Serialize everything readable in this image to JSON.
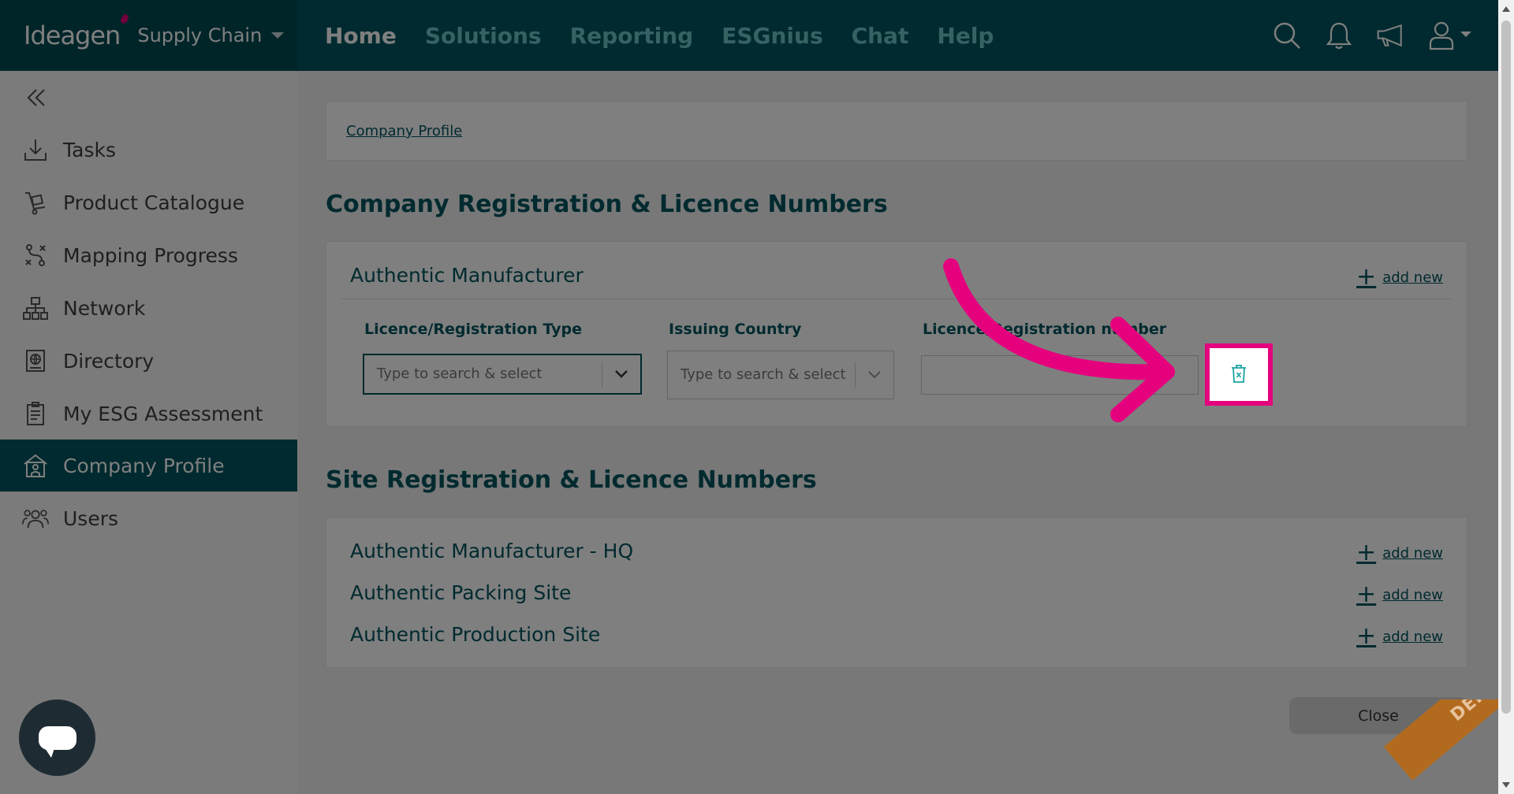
{
  "brand": {
    "logo": "Ideagen",
    "product": "Supply Chain"
  },
  "nav": {
    "items": [
      {
        "label": "Home",
        "active": true
      },
      {
        "label": "Solutions",
        "active": false
      },
      {
        "label": "Reporting",
        "active": false
      },
      {
        "label": "ESGnius",
        "active": false
      },
      {
        "label": "Chat",
        "active": false
      },
      {
        "label": "Help",
        "active": false
      }
    ]
  },
  "top_icons": [
    "search-icon",
    "bell-icon",
    "megaphone-icon",
    "user-icon"
  ],
  "sidebar": {
    "items": [
      {
        "label": "Tasks",
        "icon": "download-tray-icon"
      },
      {
        "label": "Product Catalogue",
        "icon": "trolley-icon"
      },
      {
        "label": "Mapping Progress",
        "icon": "path-icon"
      },
      {
        "label": "Network",
        "icon": "network-icon"
      },
      {
        "label": "Directory",
        "icon": "directory-icon"
      },
      {
        "label": "My ESG Assessment",
        "icon": "clipboard-icon"
      },
      {
        "label": "Company Profile",
        "icon": "building-icon",
        "active": true
      },
      {
        "label": "Users",
        "icon": "users-icon"
      }
    ]
  },
  "breadcrumb": {
    "label": "Company Profile"
  },
  "company_section": {
    "title": "Company Registration & Licence Numbers",
    "card_title": "Authentic Manufacturer",
    "add_new": "add new",
    "fields": {
      "type_label": "Licence/Registration Type",
      "type_placeholder": "Type to search & select",
      "country_label": "Issuing Country",
      "country_placeholder": "Type to search & select",
      "number_label": "Licence/Registration number",
      "number_value": ""
    }
  },
  "site_section": {
    "title": "Site Registration & Licence Numbers",
    "sites": [
      {
        "name": "Authentic Manufacturer - HQ",
        "add_new": "add new"
      },
      {
        "name": "Authentic Packing Site",
        "add_new": "add new"
      },
      {
        "name": "Authentic Production Site",
        "add_new": "add new"
      }
    ]
  },
  "close_button": "Close",
  "ribbon": "DEMO",
  "colors": {
    "brand": "#00555e",
    "accent": "#6ec5c9",
    "highlight": "#e5007e"
  }
}
